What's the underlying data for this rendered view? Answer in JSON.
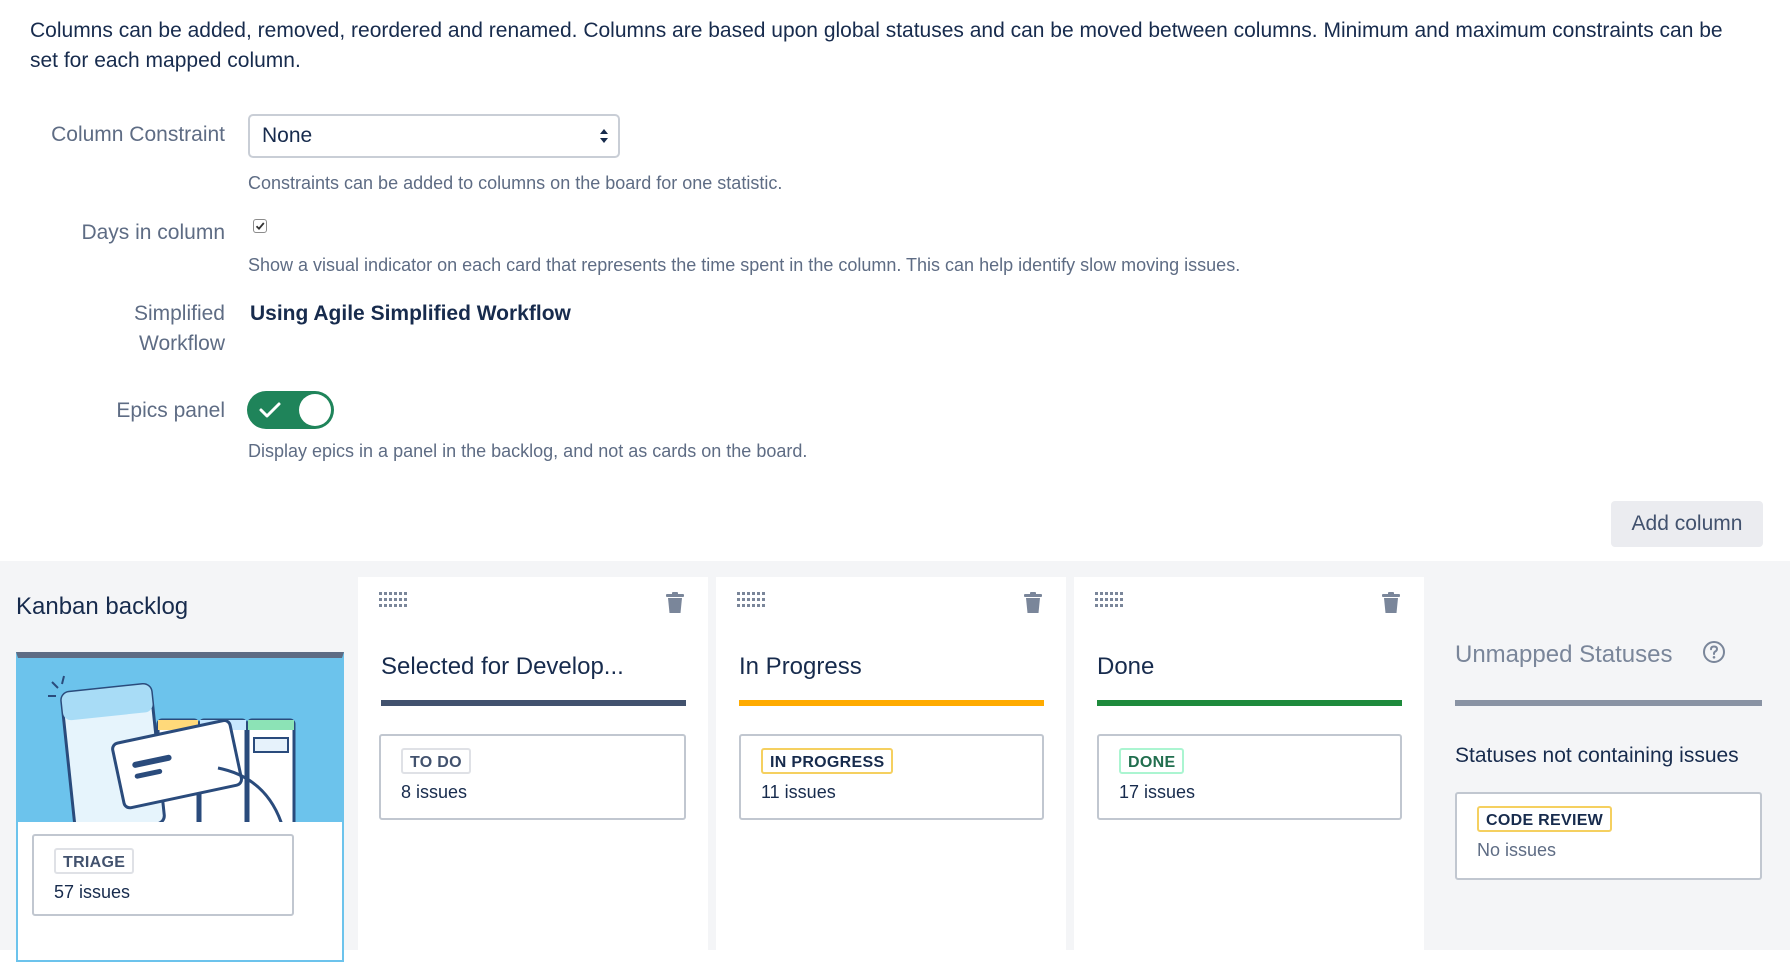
{
  "intro": "Columns can be added, removed, reordered and renamed. Columns are based upon global statuses and can be moved between columns. Minimum and maximum constraints can be set for each mapped column.",
  "settings": {
    "column_constraint": {
      "label": "Column Constraint",
      "value": "None",
      "help": "Constraints can be added to columns on the board for one statistic."
    },
    "days_in_column": {
      "label": "Days in column",
      "checked": true,
      "help": "Show a visual indicator on each card that represents the time spent in the column. This can help identify slow moving issues."
    },
    "simplified_workflow": {
      "label_line1": "Simplified",
      "label_line2": "Workflow",
      "value": "Using Agile Simplified Workflow"
    },
    "epics_panel": {
      "label": "Epics panel",
      "enabled": true,
      "help": "Display epics in a panel in the backlog, and not as cards on the board."
    }
  },
  "add_column_label": "Add column",
  "backlog": {
    "title": "Kanban backlog",
    "status": "TRIAGE",
    "count": "57 issues"
  },
  "columns": [
    {
      "title": "Selected for Develop...",
      "bar_color": "#42526e",
      "status": "TO DO",
      "status_style": "gray",
      "count": "8 issues"
    },
    {
      "title": "In Progress",
      "bar_color": "#ffab00",
      "status": "IN PROGRESS",
      "status_style": "yellow",
      "count": "11 issues"
    },
    {
      "title": "Done",
      "bar_color": "#36b37e",
      "status": "DONE",
      "status_style": "green",
      "count": "17 issues"
    }
  ],
  "unmapped": {
    "title": "Unmapped Statuses",
    "subtitle": "Statuses not containing issues",
    "status": "CODE REVIEW",
    "count": "No issues"
  },
  "colors": {
    "toggle_on": "#1f845a",
    "column_1_bar": "#42526e",
    "column_2_bar": "#ffab00",
    "column_3_bar": "#36b37e"
  }
}
